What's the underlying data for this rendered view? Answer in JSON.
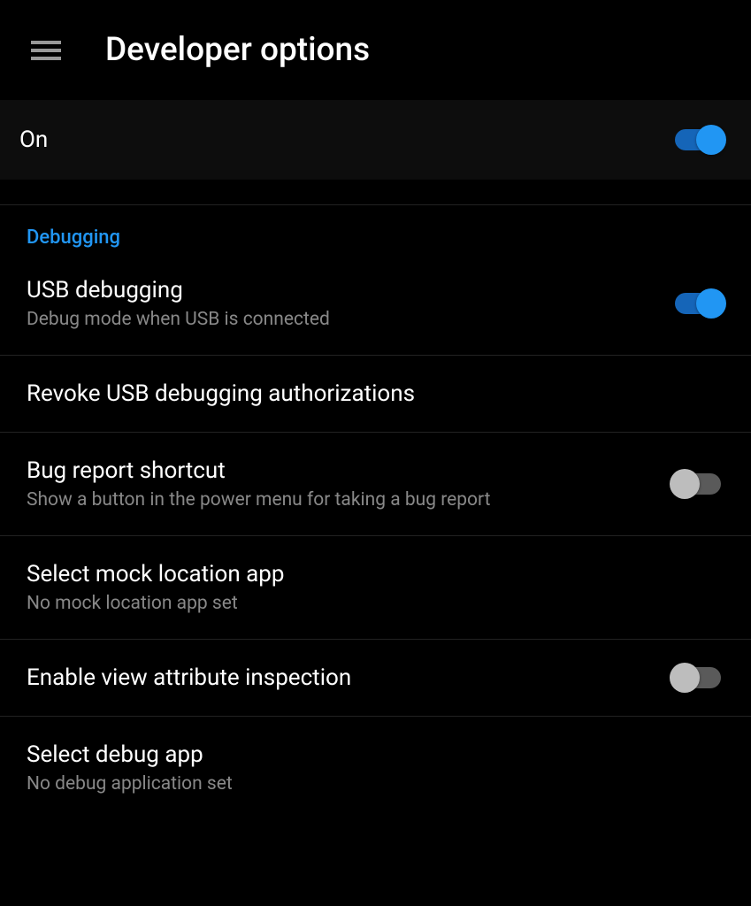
{
  "header": {
    "title": "Developer options"
  },
  "master": {
    "label": "On",
    "enabled": true
  },
  "section": {
    "title": "Debugging"
  },
  "settings": {
    "usb_debugging": {
      "title": "USB debugging",
      "subtitle": "Debug mode when USB is connected",
      "enabled": true
    },
    "revoke_auth": {
      "title": "Revoke USB debugging authorizations"
    },
    "bug_report": {
      "title": "Bug report shortcut",
      "subtitle": "Show a button in the power menu for taking a bug report",
      "enabled": false
    },
    "mock_location": {
      "title": "Select mock location app",
      "subtitle": "No mock location app set"
    },
    "view_attribute": {
      "title": "Enable view attribute inspection",
      "enabled": false
    },
    "select_debug": {
      "title": "Select debug app",
      "subtitle": "No debug application set"
    }
  }
}
